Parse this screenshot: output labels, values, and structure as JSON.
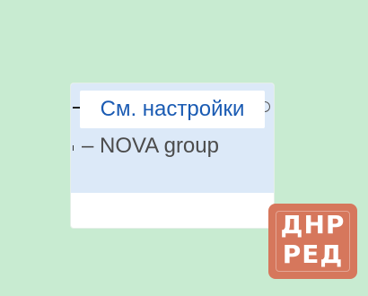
{
  "popup": {
    "settings_label": "См. настройки",
    "group_item": "– NOVA group"
  },
  "watermark": {
    "line1": "ДНР",
    "line2": "РЕД"
  }
}
